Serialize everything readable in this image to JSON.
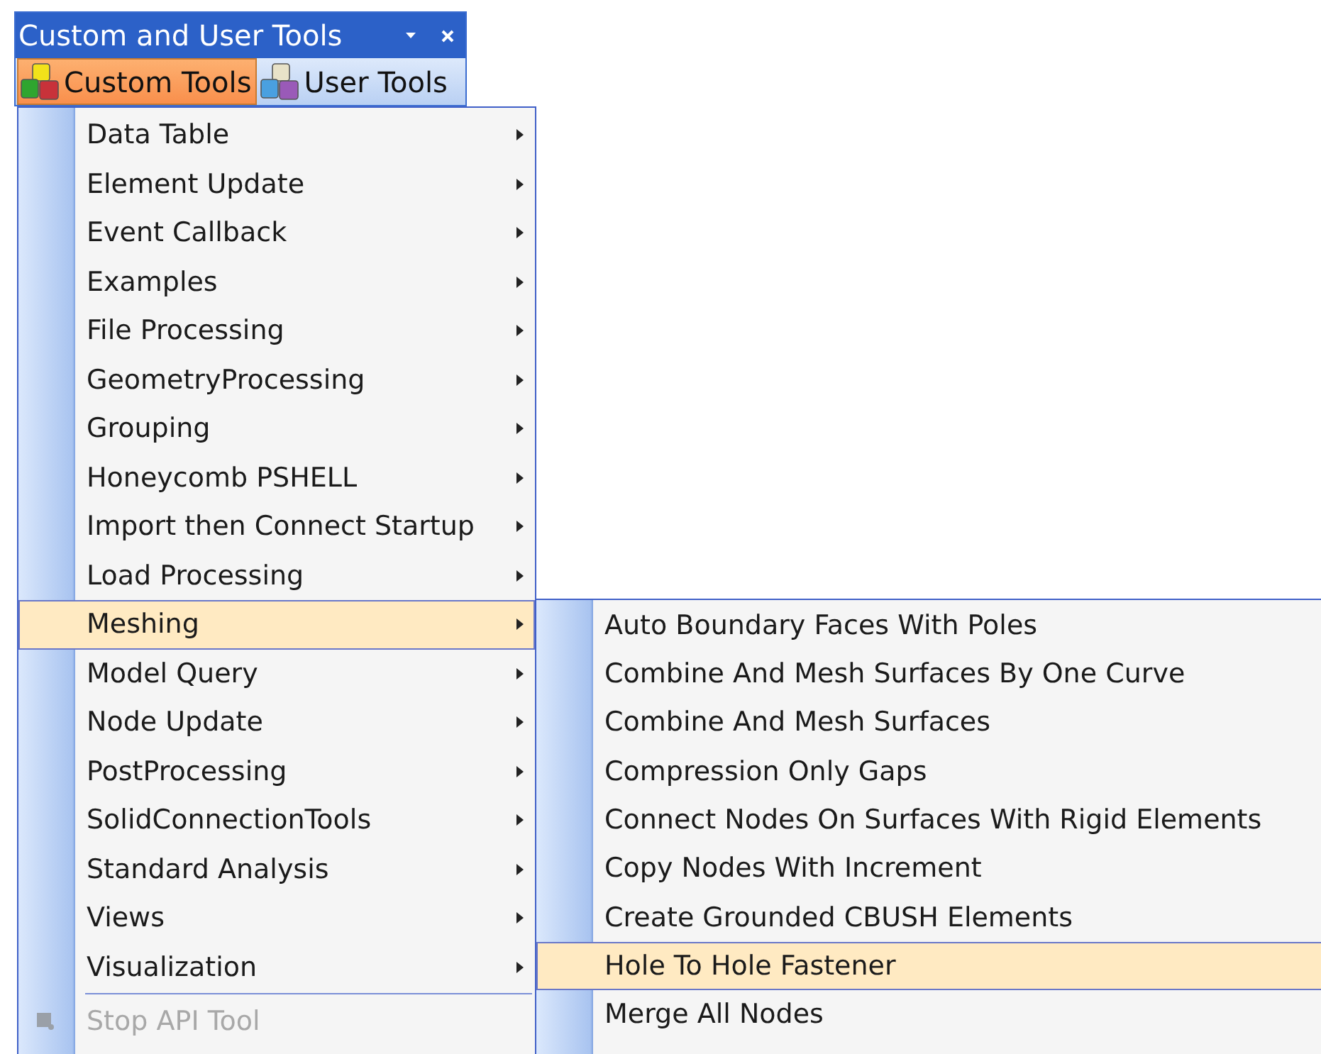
{
  "window": {
    "title": "Custom and User Tools"
  },
  "tabs": [
    {
      "label": "Custom Tools",
      "selected": true
    },
    {
      "label": "User Tools",
      "selected": false
    }
  ],
  "menu": {
    "items": [
      {
        "kind": "item",
        "label": "Data Table",
        "submenu": true,
        "selected": false,
        "disabled": false
      },
      {
        "kind": "item",
        "label": "Element Update",
        "submenu": true,
        "selected": false,
        "disabled": false
      },
      {
        "kind": "item",
        "label": "Event Callback",
        "submenu": true,
        "selected": false,
        "disabled": false
      },
      {
        "kind": "item",
        "label": "Examples",
        "submenu": true,
        "selected": false,
        "disabled": false
      },
      {
        "kind": "item",
        "label": "File Processing",
        "submenu": true,
        "selected": false,
        "disabled": false
      },
      {
        "kind": "item",
        "label": "GeometryProcessing",
        "submenu": true,
        "selected": false,
        "disabled": false
      },
      {
        "kind": "item",
        "label": "Grouping",
        "submenu": true,
        "selected": false,
        "disabled": false
      },
      {
        "kind": "item",
        "label": "Honeycomb PSHELL",
        "submenu": true,
        "selected": false,
        "disabled": false
      },
      {
        "kind": "item",
        "label": "Import then Connect Startup",
        "submenu": true,
        "selected": false,
        "disabled": false
      },
      {
        "kind": "item",
        "label": "Load Processing",
        "submenu": true,
        "selected": false,
        "disabled": false
      },
      {
        "kind": "item",
        "label": "Meshing",
        "submenu": true,
        "selected": true,
        "disabled": false
      },
      {
        "kind": "item",
        "label": "Model Query",
        "submenu": true,
        "selected": false,
        "disabled": false
      },
      {
        "kind": "item",
        "label": "Node Update",
        "submenu": true,
        "selected": false,
        "disabled": false
      },
      {
        "kind": "item",
        "label": "PostProcessing",
        "submenu": true,
        "selected": false,
        "disabled": false
      },
      {
        "kind": "item",
        "label": "SolidConnectionTools",
        "submenu": true,
        "selected": false,
        "disabled": false
      },
      {
        "kind": "item",
        "label": "Standard Analysis",
        "submenu": true,
        "selected": false,
        "disabled": false
      },
      {
        "kind": "item",
        "label": "Views",
        "submenu": true,
        "selected": false,
        "disabled": false
      },
      {
        "kind": "item",
        "label": "Visualization",
        "submenu": true,
        "selected": false,
        "disabled": false
      },
      {
        "kind": "separator"
      },
      {
        "kind": "command",
        "label": "Stop API Tool",
        "selected": false,
        "disabled": true
      }
    ]
  },
  "submenu": {
    "items": [
      {
        "label": "Auto Boundary Faces With Poles",
        "selected": false
      },
      {
        "label": "Combine And Mesh Surfaces By One Curve",
        "selected": false
      },
      {
        "label": "Combine And Mesh Surfaces",
        "selected": false
      },
      {
        "label": "Compression Only Gaps",
        "selected": false
      },
      {
        "label": "Connect Nodes On Surfaces With Rigid Elements",
        "selected": false
      },
      {
        "label": "Copy Nodes With Increment",
        "selected": false
      },
      {
        "label": "Create Grounded CBUSH Elements",
        "selected": false
      },
      {
        "label": "Hole To Hole Fastener",
        "selected": true
      },
      {
        "label": "Merge All Nodes",
        "selected": false
      }
    ]
  }
}
